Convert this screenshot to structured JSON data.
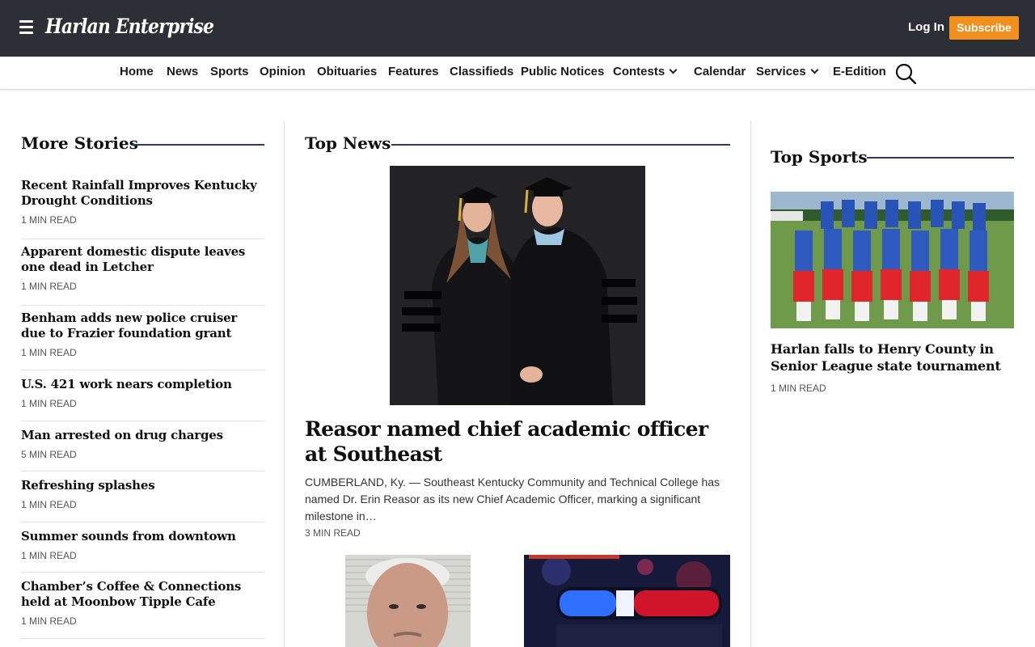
{
  "header": {
    "logo_text": "Harlan Enterprise",
    "login_label": "Log In",
    "subscribe_label": "Subscribe",
    "colors": {
      "topbar": "#2c2f36",
      "accent": "#f0901e",
      "rule": "#2d3e55"
    }
  },
  "nav": {
    "items": [
      "Home",
      "News",
      "Sports",
      "Opinion",
      "Obituaries",
      "Features",
      "Classifieds",
      "Public Notices",
      "Contests",
      "Calendar",
      "Services",
      "E-Edition"
    ],
    "icons": {
      "menu": "hamburger-menu-icon",
      "search": "search-icon",
      "dropdown": "chevron-down-icon"
    }
  },
  "more_stories": {
    "title": "More Stories",
    "items": [
      {
        "title": "Recent Rainfall Improves Kentucky Drought Conditions",
        "read_time": "1 MIN READ"
      },
      {
        "title": "Apparent domestic dispute leaves one dead in Letcher",
        "read_time": "1 MIN READ"
      },
      {
        "title": "Benham adds new police cruiser due to Frazier foundation grant",
        "read_time": "1 MIN READ"
      },
      {
        "title": "U.S. 421 work nears completion",
        "read_time": "1 MIN READ"
      },
      {
        "title": "Man arrested on drug charges",
        "read_time": "5 MIN READ"
      },
      {
        "title": "Refreshing splashes",
        "read_time": "1 MIN READ"
      },
      {
        "title": "Summer sounds from downtown",
        "read_time": "1 MIN READ"
      },
      {
        "title": "Chamber’s Coffee & Connections held at Moonbow Tipple Cafe",
        "read_time": "1 MIN READ"
      }
    ]
  },
  "top_news": {
    "title": "Top News",
    "lead": {
      "headline": "Reasor named chief academic officer at Southeast",
      "excerpt": "CUMBERLAND, Ky. — Southeast Kentucky Community and Technical College has named Dr. Erin Reasor as its new Chief Academic Officer, marking a significant milestone in…",
      "read_time": "3 MIN READ"
    }
  },
  "top_sports": {
    "title": "Top Sports",
    "story": {
      "title": "Harlan falls to Henry County in Senior League state tournament",
      "read_time": "1 MIN READ"
    }
  }
}
